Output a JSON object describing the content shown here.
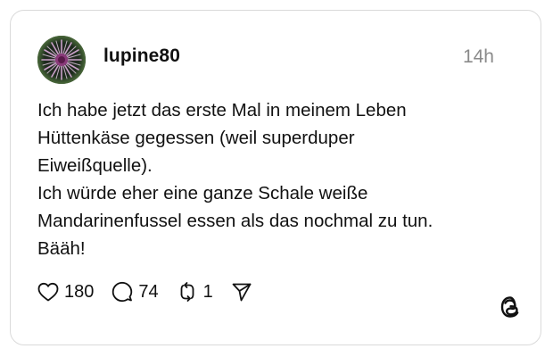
{
  "post": {
    "username": "lupine80",
    "timestamp": "14h",
    "text_lines": [
      "Ich habe jetzt das erste Mal in meinem Leben",
      "Hüttenkäse gegessen (weil superduper",
      "Eiweißquelle).",
      "Ich würde eher eine ganze Schale weiße",
      "Mandarinenfussel essen als das nochmal zu tun.",
      "Bääh!"
    ]
  },
  "actions": {
    "likes": "180",
    "comments": "74",
    "reposts": "1"
  },
  "icons": {
    "like": "heart-icon",
    "comment": "speech-bubble-icon",
    "repost": "repost-arrows-icon",
    "share": "paper-plane-icon",
    "brand": "threads-logo-icon"
  }
}
